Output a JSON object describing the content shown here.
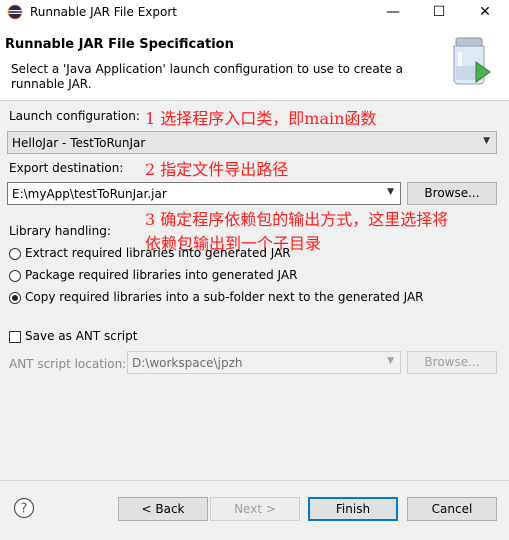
{
  "window": {
    "title": "Runnable JAR File Export",
    "min": "—",
    "max": "☐",
    "close": "✕"
  },
  "header": {
    "title": "Runnable JAR File Specification",
    "description": "Select a 'Java Application' launch configuration to use to create a runnable JAR."
  },
  "launch": {
    "label": "Launch configuration:",
    "value": "HelloJar - TestToRunJar"
  },
  "export": {
    "label": "Export destination:",
    "value": "E:\\myApp\\testToRunJar.jar",
    "browse": "Browse..."
  },
  "annotations": {
    "a1": "1 选择程序入口类，即main函数",
    "a2": "2 指定文件导出路径",
    "a3_line1": "3 确定程序依赖包的输出方式，这里选择将",
    "a3_line2": "依赖包输出到一个子目录"
  },
  "library": {
    "label": "Library handling:",
    "options": [
      {
        "label": "Extract required libraries into generated JAR",
        "selected": false
      },
      {
        "label": "Package required libraries into generated JAR",
        "selected": false
      },
      {
        "label": "Copy required libraries into a sub-folder next to the generated JAR",
        "selected": true
      }
    ]
  },
  "ant": {
    "save_label": "Save as ANT script",
    "checked": false,
    "location_label": "ANT script location:",
    "location_value": "D:\\workspace\\jpzh",
    "browse": "Browse..."
  },
  "buttons": {
    "back": "< Back",
    "next": "Next >",
    "finish": "Finish",
    "cancel": "Cancel"
  },
  "icons": {
    "app": "eclipse-icon",
    "wizard": "jar-export-icon",
    "help": "help-icon"
  }
}
